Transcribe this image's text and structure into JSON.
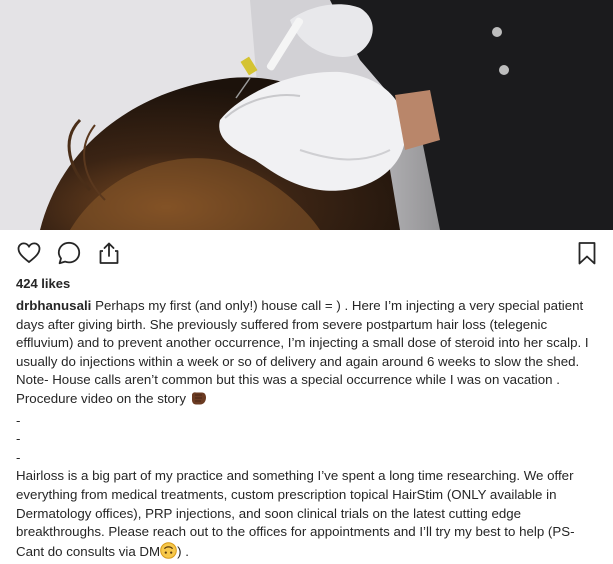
{
  "post": {
    "image": {
      "alt_icon": "photo-of-scalp-injection"
    },
    "actions": {
      "like_icon": "heart-outline-icon",
      "comment_icon": "comment-bubble-icon",
      "share_icon": "share-upload-icon",
      "save_icon": "bookmark-outline-icon"
    },
    "likes_text": "424 likes",
    "caption": {
      "username": "drbhanusali",
      "paragraph1": " Perhaps my first (and only!) house call = ) . Here I’m injecting a very special patient days after giving birth. She previously suffered from severe postpartum hair loss (telegenic effluvium) and to prevent another occurrence, I’m injecting a small dose of steroid into her scalp. I usually do injections within a week or so of delivery and again around 6 weeks to slow the shed. Note- House calls aren’t common but this was a special occurrence while I was on vacation . Procedure video on the story ",
      "emoji1": "fist-bump-emoji",
      "dashes": [
        "-",
        "-",
        "-"
      ],
      "paragraph2": "Hairloss is a big part of my practice and something I’ve spent a long time researching. We offer everything from medical treatments, custom prescription topical HairStim (ONLY available in Dermatology offices), PRP injections, and soon clinical trials on the latest cutting edge breakthroughs. Please reach out to the offices for appointments and I’ll try my best to help (PS- Cant do consults via DM",
      "emoji2": "upside-down-face-emoji",
      "paragraph2_end": ") ."
    }
  }
}
